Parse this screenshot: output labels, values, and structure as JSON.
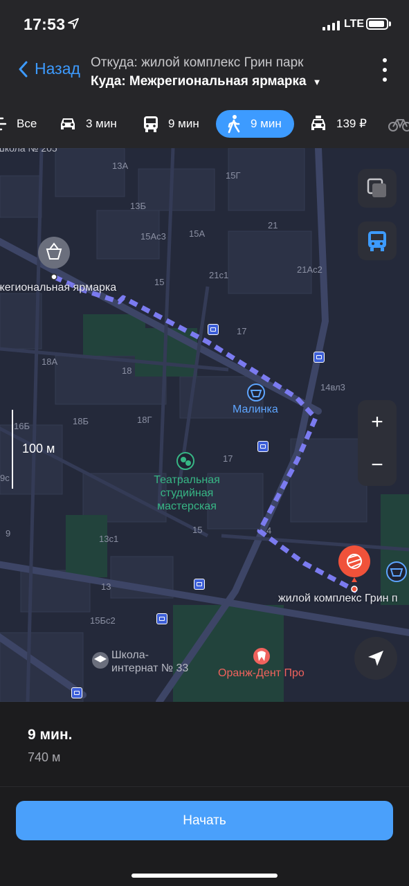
{
  "status_bar": {
    "time": "17:53",
    "network": "LTE"
  },
  "header": {
    "back_label": "Назад",
    "from": "Откуда: жилой комплекс Грин парк",
    "to": "Куда: Межрегиональная ярмарка"
  },
  "modes": [
    {
      "id": "all",
      "label": "Все",
      "icon": "filter-icon"
    },
    {
      "id": "car",
      "label": "3 мин",
      "icon": "car-icon"
    },
    {
      "id": "transit",
      "label": "9 мин",
      "icon": "bus-icon"
    },
    {
      "id": "walk",
      "label": "9 мин",
      "icon": "walk-icon",
      "active": true
    },
    {
      "id": "taxi",
      "label": "139 ₽",
      "icon": "taxi-icon"
    },
    {
      "id": "bike",
      "label": "",
      "icon": "bike-icon"
    }
  ],
  "map": {
    "scale_label": "100 м",
    "places": {
      "destination": "жегиональная ярмарка",
      "origin": "жилой комплекс Грин п",
      "shop": "Малинка",
      "theatre": "Театральная\nстудийная\nмастерская",
      "dentist": "Оранж-Дент Про",
      "school": "Школа-\nинтернат № 33",
      "school_top": "Школа № 205"
    },
    "building_numbers": [
      "13А",
      "13Б",
      "15Г",
      "15Ас3",
      "15А",
      "21",
      "21с1",
      "21Ас2",
      "15",
      "17",
      "14вл3",
      "18А",
      "18",
      "18Б",
      "18Г",
      "16Б",
      "17",
      "15",
      "9",
      "13с1",
      "13",
      "15Бс2",
      "4",
      "9с"
    ],
    "colors": {
      "route": "#7b7bf0",
      "accent": "#3d9bff",
      "origin_pin": "#f0523a"
    }
  },
  "route_summary": {
    "duration": "9 мин.",
    "distance": "740 м"
  },
  "start_button": "Начать"
}
